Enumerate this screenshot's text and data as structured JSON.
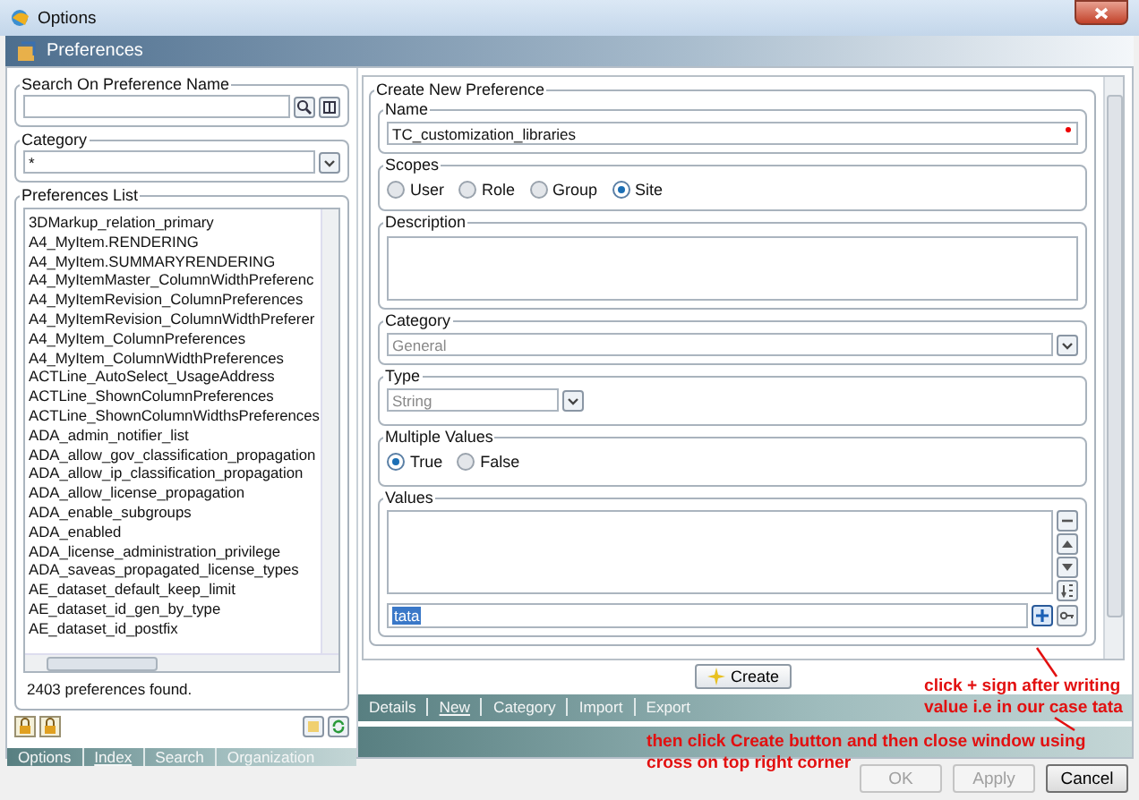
{
  "window": {
    "title": "Options"
  },
  "header": {
    "title": "Preferences"
  },
  "search": {
    "label": "Search On Preference Name"
  },
  "category_filter": {
    "label": "Category",
    "value": "*"
  },
  "preferences_list": {
    "label": "Preferences List",
    "items": [
      "3DMarkup_relation_primary",
      "A4_MyItem.RENDERING",
      "A4_MyItem.SUMMARYRENDERING",
      "A4_MyItemMaster_ColumnWidthPreferenc",
      "A4_MyItemRevision_ColumnPreferences",
      "A4_MyItemRevision_ColumnWidthPreferer",
      "A4_MyItem_ColumnPreferences",
      "A4_MyItem_ColumnWidthPreferences",
      "ACTLine_AutoSelect_UsageAddress",
      "ACTLine_ShownColumnPreferences",
      "ACTLine_ShownColumnWidthsPreferences",
      "ADA_admin_notifier_list",
      "ADA_allow_gov_classification_propagation",
      "ADA_allow_ip_classification_propagation",
      "ADA_allow_license_propagation",
      "ADA_enable_subgroups",
      "ADA_enabled",
      "ADA_license_administration_privilege",
      "ADA_saveas_propagated_license_types",
      "AE_dataset_default_keep_limit",
      "AE_dataset_id_gen_by_type",
      "AE_dataset_id_postfix"
    ],
    "status": "2403 preferences found."
  },
  "left_tabs": [
    {
      "label": "Options",
      "selected": false
    },
    {
      "label": "Index",
      "selected": true
    },
    {
      "label": "Search",
      "selected": false
    },
    {
      "label": "Organization",
      "selected": false
    }
  ],
  "create": {
    "title": "Create New Preference",
    "name": {
      "label": "Name",
      "value": "TC_customization_libraries",
      "required": true
    },
    "scopes": {
      "label": "Scopes",
      "options": [
        {
          "label": "User",
          "selected": false
        },
        {
          "label": "Role",
          "selected": false
        },
        {
          "label": "Group",
          "selected": false
        },
        {
          "label": "Site",
          "selected": true
        }
      ]
    },
    "description": {
      "label": "Description"
    },
    "category": {
      "label": "Category",
      "value": "General"
    },
    "type": {
      "label": "Type",
      "value": "String"
    },
    "multiple_values": {
      "label": "Multiple Values",
      "options": [
        {
          "label": "True",
          "selected": true
        },
        {
          "label": "False",
          "selected": false
        }
      ]
    },
    "values": {
      "label": "Values",
      "input": "tata"
    },
    "create_button": "Create"
  },
  "right_tabs": [
    {
      "label": "Details",
      "selected": false
    },
    {
      "label": "New",
      "selected": true
    },
    {
      "label": "Category",
      "selected": false
    },
    {
      "label": "Import",
      "selected": false
    },
    {
      "label": "Export",
      "selected": false
    }
  ],
  "buttons": [
    {
      "label": "OK",
      "disabled": true
    },
    {
      "label": "Apply",
      "disabled": true
    },
    {
      "label": "Cancel",
      "disabled": false
    }
  ],
  "annotations": [
    {
      "lines": [
        "click +  sign after writing",
        "value i.e in our case tata"
      ]
    },
    {
      "lines": [
        "then click Create button and then close window using",
        "cross on top right corner"
      ]
    }
  ]
}
